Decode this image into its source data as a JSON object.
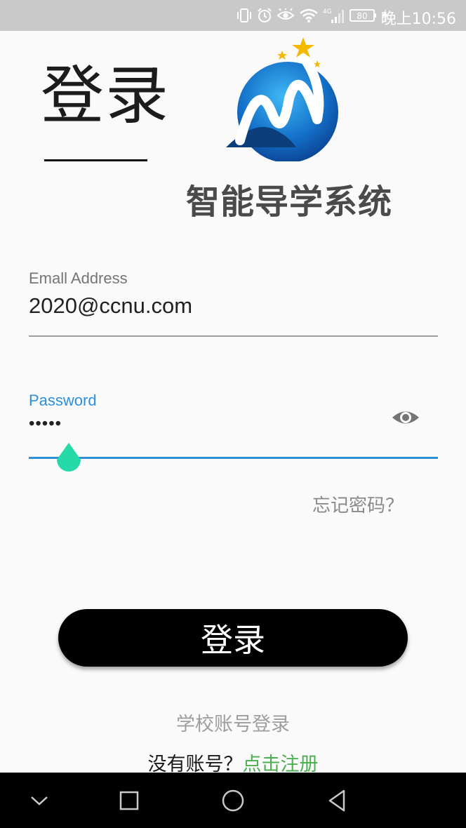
{
  "status_bar": {
    "time": "晚上10:56",
    "battery": "80",
    "network": "4G"
  },
  "page_title": "登录",
  "logo": {
    "text": "智能导学系统"
  },
  "email": {
    "label": "Emall Address",
    "value": "2020@ccnu.com"
  },
  "password": {
    "label": "Password",
    "masked_value": "•••••"
  },
  "forgot_password": "忘记密码？",
  "login_button": "登录",
  "school_login": "学校账号登录",
  "register": {
    "prompt": "没有账号？",
    "link": "点击注册"
  },
  "colors": {
    "accent_blue": "#2d8fd8",
    "register_green": "#4caf50",
    "cursor_handle": "#26d9a8",
    "button_black": "#000000"
  },
  "icons": [
    "vibrate-icon",
    "alarm-icon",
    "eye-comfort-icon",
    "wifi-icon",
    "signal-icon",
    "battery-icon",
    "charging-icon",
    "eye-icon",
    "back-icon",
    "home-icon",
    "recents-icon",
    "hide-nav-icon"
  ]
}
